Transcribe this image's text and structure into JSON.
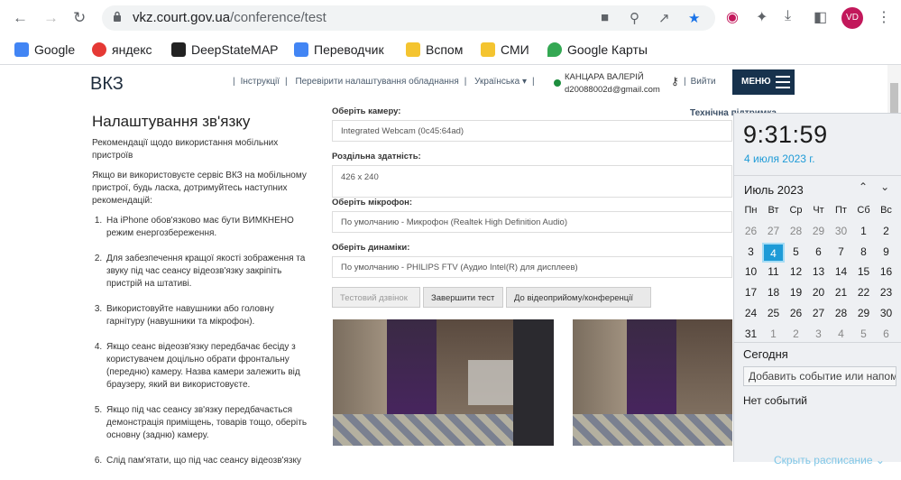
{
  "browser": {
    "url_host": "vkz.court.gov.ua",
    "url_path": "/conference/test",
    "avatar_initials": "VD",
    "bookmarks": [
      {
        "label": "Google",
        "icon": "google-icon",
        "color": "#4285f4"
      },
      {
        "label": "яндекс",
        "icon": "yandex-icon",
        "color": "#e53935"
      },
      {
        "label": "DeepStateMAP",
        "icon": "deepstate-icon",
        "color": "#222222"
      },
      {
        "label": "Переводчик",
        "icon": "translate-icon",
        "color": "#4285f4"
      },
      {
        "label": "Вспом",
        "icon": "folder-icon",
        "color": "#f4c430"
      },
      {
        "label": "СМИ",
        "icon": "folder-icon",
        "color": "#f4c430"
      },
      {
        "label": "Google Карты",
        "icon": "maps-icon",
        "color": "#34a853"
      }
    ]
  },
  "site": {
    "logo": "ВКЗ",
    "links": [
      "Інструкції",
      "Перевірити налаштування обладнання",
      "Українська ▾"
    ],
    "user_name": "КАНЦАРА ВАЛЕРІЙ",
    "user_email": "d20088002d@gmail.com",
    "exit": "Вийти",
    "menu": "МЕНЮ",
    "tech_support": "Технічна підтримка"
  },
  "left": {
    "title": "Налаштування зв'язку",
    "sub": "Рекомендації щодо використання мобільних пристроїв",
    "intro": "Якщо ви використовуєте сервіс ВКЗ на мобільному пристрої, будь ласка, дотримуйтесь наступних рекомендацій:",
    "items": [
      "На iPhone обов'язково має бути ВИМКНЕНО режим енергозбереження.",
      "Для забезпечення кращої якості зображення та звуку під час сеансу відеозв'язку закріпіть пристрій на штативі.",
      "Використовуйте навушники або головну гарнітуру (навушники та мікрофон).",
      "Якщо сеанс відеозв'язку передбачає бесіду з користувачем доцільно обрати фронтальну (передню) камеру. Назва камери залежить від браузеру, який ви використовуєте.",
      "Якщо під час сеансу зв'язку передбачається демонстрація приміщень, товарів тощо, оберіть основну (задню) камеру.",
      "Слід пам'ятати, що під час сеансу відеозв'язку"
    ]
  },
  "form": {
    "camera_label": "Оберіть камеру:",
    "camera_value": "Integrated Webcam (0c45:64ad)",
    "resolution_label": "Роздільна здатність:",
    "resolution_value": "426 x 240",
    "mic_label": "Оберіть мікрофон:",
    "mic_value": "По умолчанию - Микрофон (Realtek High Definition Audio)",
    "speaker_label": "Оберіть динаміки:",
    "speaker_value": "По умолчанию - PHILIPS FTV (Аудио Intel(R) для дисплеев)",
    "btn_test_call": "Тестовий дзвінок",
    "btn_finish": "Завершити тест",
    "btn_conference": "До відеоприйому/конференції"
  },
  "flyout": {
    "time": "9:31:59",
    "date": "4 июля 2023 г.",
    "month": "Июль 2023",
    "weekdays": [
      "Пн",
      "Вт",
      "Ср",
      "Чт",
      "Пт",
      "Сб",
      "Вс"
    ],
    "weeks": [
      [
        "26",
        "27",
        "28",
        "29",
        "30",
        "1",
        "2"
      ],
      [
        "3",
        "4",
        "5",
        "6",
        "7",
        "8",
        "9"
      ],
      [
        "10",
        "11",
        "12",
        "13",
        "14",
        "15",
        "16"
      ],
      [
        "17",
        "18",
        "19",
        "20",
        "21",
        "22",
        "23"
      ],
      [
        "24",
        "25",
        "26",
        "27",
        "28",
        "29",
        "30"
      ],
      [
        "31",
        "1",
        "2",
        "3",
        "4",
        "5",
        "6"
      ]
    ],
    "today_label": "Сегодня",
    "add_event": "Добавить событие или напоминание",
    "no_events": "Нет событий",
    "hide_schedule": "Скрыть расписание ⌄",
    "accent": "#1e9bd7"
  }
}
